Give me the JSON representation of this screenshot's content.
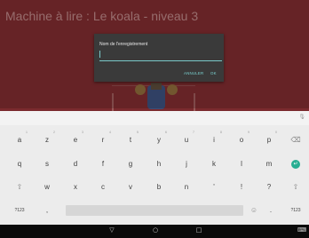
{
  "app": {
    "title": "Machine à lire : Le koala - niveau 3"
  },
  "dialog": {
    "label": "Nom de l'enregistrement",
    "input_value": "",
    "cancel_label": "ANNULER",
    "ok_label": "OK"
  },
  "keyboard": {
    "mic_icon": "🎙",
    "row1": [
      {
        "k": "a",
        "h": "1"
      },
      {
        "k": "z",
        "h": "2"
      },
      {
        "k": "e",
        "h": "3"
      },
      {
        "k": "r",
        "h": "4"
      },
      {
        "k": "t",
        "h": "5"
      },
      {
        "k": "y",
        "h": "6"
      },
      {
        "k": "u",
        "h": "7"
      },
      {
        "k": "i",
        "h": "8"
      },
      {
        "k": "o",
        "h": "9"
      },
      {
        "k": "p",
        "h": "0"
      },
      {
        "k": "⌫",
        "h": ""
      }
    ],
    "row2": [
      "q",
      "s",
      "d",
      "f",
      "g",
      "h",
      "j",
      "k",
      "l",
      "m"
    ],
    "row3": [
      "⇧",
      "w",
      "x",
      "c",
      "v",
      "b",
      "n",
      "'",
      "!",
      "?",
      "⇧"
    ],
    "row4_left": [
      "?123",
      ","
    ],
    "row4_right": [
      "☺",
      ".",
      "?123"
    ],
    "enter_glyph": "↵"
  },
  "navbar": {
    "back": "▽",
    "home": "○",
    "recents": "□",
    "keyboard": "⌨"
  },
  "colors": {
    "app_background": "#7d2b2f",
    "dialog_background": "#3a3a3a",
    "accent": "#7ad0cf",
    "enter_key": "#27ae92"
  }
}
